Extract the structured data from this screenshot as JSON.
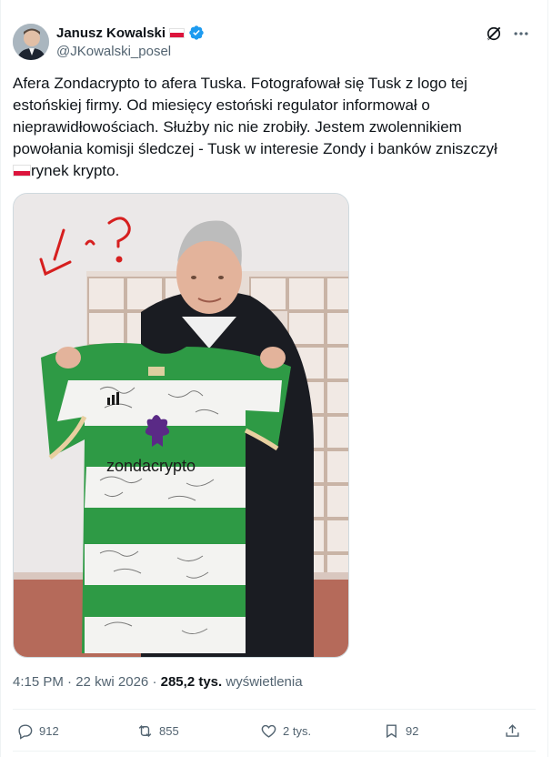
{
  "author": {
    "display_name": "Janusz Kowalski",
    "handle": "@JKowalski_posel"
  },
  "tweet": {
    "text": "Afera Zondacrypto to afera Tuska. Fotografował się Tusk z logo tej\nestońskiej firmy. Od miesięcy estoński regulator informował o\nnieprawidłowościach. Służby nic nie zrobiły. Jestem zwolennikiem\npowołania komisji śledczej - Tusk w interesie Zondy i banków zniszczył\n",
    "text_tail": "rynek krypto."
  },
  "photo": {
    "shirt_logo_text": "zondacrypto",
    "handwritten_marks": "! ?"
  },
  "meta": {
    "time": "4:15 PM",
    "date": "22 kwi 2026",
    "separator": " · ",
    "views_count": "285,2 tys.",
    "views_label": "wyświetlenia"
  },
  "actions": {
    "replies": "912",
    "reposts": "855",
    "likes": "2 tys.",
    "bookmarks": "92"
  },
  "icons": [
    "verified-badge-icon",
    "poland-flag-icon",
    "grok-icon",
    "more-icon",
    "reply-icon",
    "repost-icon",
    "like-icon",
    "bookmark-icon",
    "share-icon"
  ],
  "colors": {
    "accent": "#1d9bf0",
    "text": "#0f1419",
    "muted": "#536471",
    "border": "#eff3f4",
    "flag_red": "#dc143c",
    "shirt_green": "#2e9a45"
  }
}
